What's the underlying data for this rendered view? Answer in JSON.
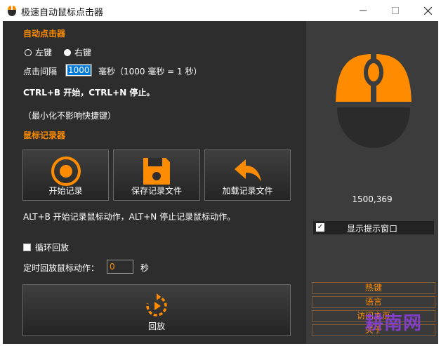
{
  "window": {
    "title": "极速自动鼠标点击器",
    "min_glyph": "—",
    "max_glyph": "☐",
    "close_glyph": "✕"
  },
  "auto_clicker": {
    "section_title": "自动点击器",
    "left_label": "左键",
    "right_label": "右键",
    "selected": "left",
    "interval_label": "点击间隔",
    "interval_value": "1000",
    "interval_unit": "毫秒（1000 毫秒 = 1 秒）",
    "hotkey_text": "CTRL+B 开始，CTRL+N 停止。",
    "minimize_note": "（最小化不影响快捷键）"
  },
  "recorder": {
    "section_title": "鼠标记录器",
    "start_label": "开始记录",
    "save_label": "保存记录文件",
    "load_label": "加载记录文件",
    "hotkey_text": "ALT+B 开始记录鼠标动作，ALT+N 停止记录鼠标动作。",
    "loop_label": "循环回放",
    "timed_label": "定时回放鼠标动作：",
    "timed_value": "0",
    "timed_unit": "秒",
    "replay_label": "回放"
  },
  "side": {
    "coordinates": "1500,369",
    "tooltip_label": "显示提示窗口",
    "tooltip_check": "✓",
    "hotkeys_label": "热键",
    "language_label": "语言",
    "homepage_label": "访问主页",
    "about_label": "关于"
  },
  "watermark": "耕南网",
  "colors": {
    "accent": "#ff8c00",
    "background": "#2d2d2d",
    "side_panel": "#3c3c3c",
    "mouse_body": "#2b2b2b"
  },
  "icons": {
    "start": "record-icon",
    "save": "floppy-disk-icon",
    "load": "undo-arrow-icon",
    "replay": "replay-icon"
  }
}
